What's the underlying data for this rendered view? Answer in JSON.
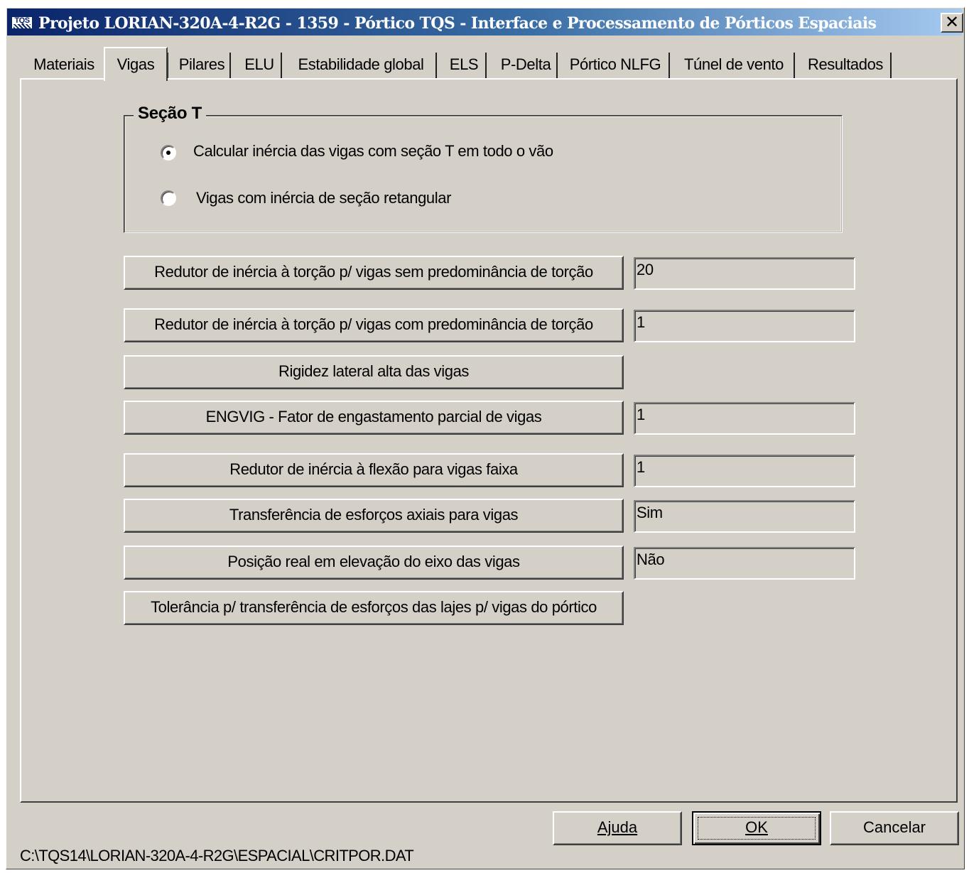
{
  "window": {
    "title": "Projeto LORIAN-320A-4-R2G - 1359 - Pórtico TQS - Interface e Processamento de Pórticos Espaciais",
    "logo_text": "TQS",
    "close_glyph": "✕"
  },
  "tabs": [
    {
      "label": "Materiais",
      "active": false
    },
    {
      "label": "Vigas",
      "active": true
    },
    {
      "label": "Pilares",
      "active": false
    },
    {
      "label": "ELU",
      "active": false
    },
    {
      "label": "Estabilidade global",
      "active": false
    },
    {
      "label": "ELS",
      "active": false
    },
    {
      "label": "P-Delta",
      "active": false
    },
    {
      "label": "Pórtico NLFG",
      "active": false
    },
    {
      "label": "Túnel de vento",
      "active": false
    },
    {
      "label": "Resultados",
      "active": false
    }
  ],
  "secao_t": {
    "title": "Seção T",
    "options": [
      {
        "label": "Calcular inércia das vigas com seção T em todo o vão",
        "selected": true
      },
      {
        "label": "Vigas com inércia de seção retangular",
        "selected": false
      }
    ]
  },
  "settings": [
    {
      "button": "Redutor de inércia à torção p/ vigas sem predominância de torção",
      "value": "20"
    },
    {
      "button": "Redutor de inércia à torção p/ vigas com predominância de torção",
      "value": "1"
    },
    {
      "button": "Rigidez lateral alta das vigas",
      "value": null
    },
    {
      "button": "ENGVIG - Fator de engastamento parcial de vigas",
      "value": "1"
    },
    {
      "button": "Redutor de inércia à flexão para vigas faixa",
      "value": "1"
    },
    {
      "button": "Transferência de esforços axiais para vigas",
      "value": "Sim"
    },
    {
      "button": "Posição real em elevação do eixo das vigas",
      "value": "Não"
    },
    {
      "button": "Tolerância p/ transferência de esforços das lajes p/ vigas do pórtico",
      "value": null
    }
  ],
  "footer": {
    "path": "C:\\TQS14\\LORIAN-320A-4-R2G\\ESPACIAL\\CRITPOR.DAT",
    "help_label": "Ajuda",
    "ok_label": "OK",
    "cancel_label": "Cancelar"
  },
  "colors": {
    "face": "#d4d0c8",
    "title_start": "#0a246a",
    "title_end": "#a6caf0"
  }
}
